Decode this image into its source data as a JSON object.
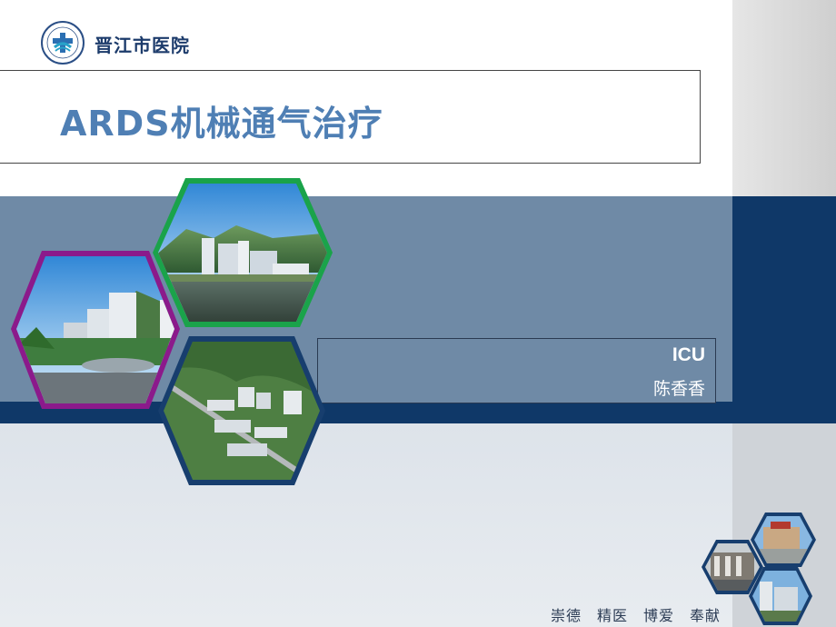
{
  "header": {
    "hospital_name": "晋江市医院",
    "logo_name": "晋江市医院"
  },
  "title": "ARDS机械通气治疗",
  "info": {
    "department": "ICU",
    "author": "陈香香"
  },
  "footer": {
    "motto": "崇德　精医　博爱　奉献"
  },
  "colors": {
    "title_blue": "#4f7fb4",
    "steel_band": "#6f8aa6",
    "navy": "#0f3868",
    "hex_green": "#1aa34a",
    "hex_purple": "#8b1a8b",
    "hex_navy": "#173e6e"
  },
  "images": [
    {
      "name": "hospital-building-photo",
      "frame": "green"
    },
    {
      "name": "hospital-campus-photo",
      "frame": "purple"
    },
    {
      "name": "hospital-aerial-photo",
      "frame": "navy"
    },
    {
      "name": "small-building-photo-1",
      "frame": "navy"
    },
    {
      "name": "small-building-photo-2",
      "frame": "navy"
    },
    {
      "name": "small-building-photo-3",
      "frame": "navy"
    }
  ]
}
